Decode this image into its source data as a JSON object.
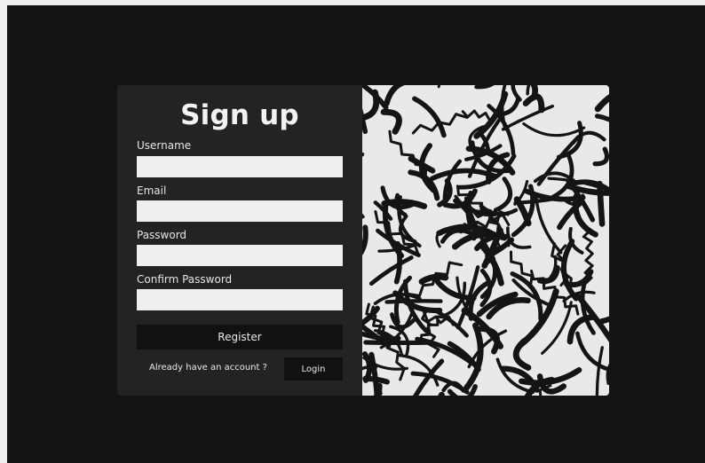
{
  "form": {
    "title": "Sign up",
    "fields": [
      {
        "label": "Username",
        "value": "",
        "placeholder": ""
      },
      {
        "label": "Email",
        "value": "",
        "placeholder": ""
      },
      {
        "label": "Password",
        "value": "",
        "placeholder": ""
      },
      {
        "label": "Confirm Password",
        "value": "",
        "placeholder": ""
      }
    ],
    "register_label": "Register",
    "already_text": "Already have an account ?",
    "login_label": "Login"
  },
  "art": {
    "icon": "abstract-squiggle-pattern",
    "background_color": "#e9e9e9",
    "stroke_color": "#141414"
  },
  "colors": {
    "page_background": "#141414",
    "card_background": "#232323",
    "button_background": "#111111",
    "input_background": "#efefef",
    "text": "#f2f2f2"
  }
}
